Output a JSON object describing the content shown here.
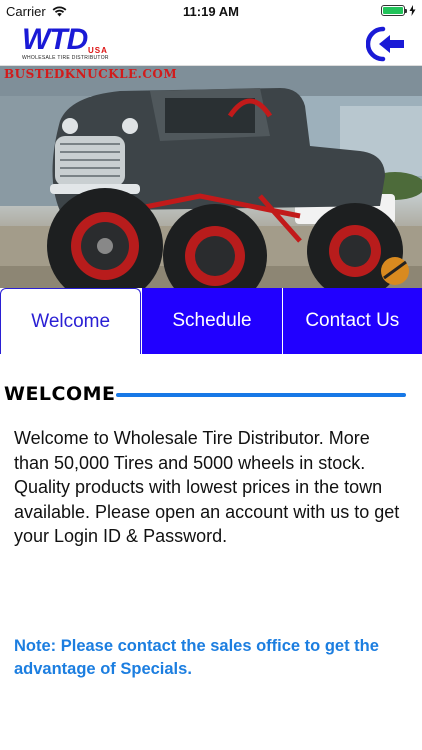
{
  "status_bar": {
    "carrier": "Carrier",
    "time": "11:19 AM",
    "battery_level": 1.0,
    "battery_color": "#22c35a"
  },
  "nav": {
    "logo_text": "WTD",
    "logo_sub_text": "USA",
    "logo_tagline": "WHOLESALE TIRE DISTRIBUTOR",
    "back_icon": "back-arrow-icon"
  },
  "hero": {
    "watermark": "BUSTEDKNUCKLE.COM",
    "logo_badge": "BUSTED KNUCKLE"
  },
  "tabs": [
    {
      "label": "Welcome",
      "active": true
    },
    {
      "label": "Schedule",
      "active": false
    },
    {
      "label": "Contact Us",
      "active": false
    }
  ],
  "content": {
    "heading": "WELCOME",
    "body": "Welcome to Wholesale Tire Distributor. More than 50,000 Tires and 5000 wheels in stock. Quality products with lowest prices in the town available. Please open an account with us to get your Login ID & Password.",
    "note": "Note: Please contact the sales office to get the advantage of Specials."
  },
  "colors": {
    "brand_blue": "#2100ff",
    "accent_line": "#1778e6",
    "note_blue": "#1c7ee0"
  }
}
